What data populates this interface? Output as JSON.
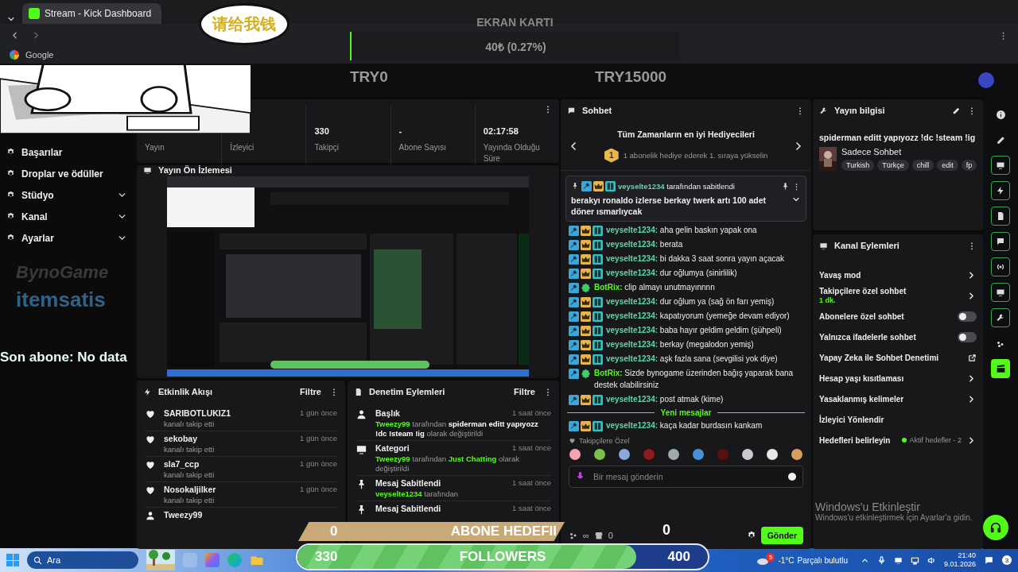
{
  "browser": {
    "tab_title": "Stream - Kick Dashboard",
    "bookmark": "Google"
  },
  "sticker": {
    "speech": "请给我钱"
  },
  "donation_widget": {
    "title": "EKRAN KARTI",
    "amount": "40₺ (0.27%)",
    "start": "TRY0",
    "goal": "TRY15000"
  },
  "sponsor_logos": [
    "BynoGame",
    "itemsatis"
  ],
  "sidebar": {
    "items": [
      {
        "label": "Başarılar",
        "kind": "link"
      },
      {
        "label": "Droplar ve ödüller",
        "kind": "link"
      },
      {
        "label": "Stüdyo",
        "kind": "group",
        "expanded": false
      },
      {
        "label": "Kanal",
        "kind": "group",
        "expanded": false
      },
      {
        "label": "Ayarlar",
        "kind": "group",
        "expanded": false
      }
    ]
  },
  "stats": [
    {
      "label": "Yayın"
    },
    {
      "label": "İzleyici"
    },
    {
      "value": "330",
      "label": "Takipçi"
    },
    {
      "value": "-",
      "label": "Abone Sayısı"
    },
    {
      "value": "02:17:58",
      "label": "Yayında Olduğu Süre"
    }
  ],
  "preview": {
    "title": "Yayın Ön İzlemesi",
    "kind": "picture"
  },
  "activity": {
    "title": "Etkinlik Akışı",
    "filter": "Filtre",
    "items": [
      {
        "kind": "follow",
        "name": "SARIBOTLUKIZ1",
        "detail": "kanalı takip etti",
        "time": "1 gün önce"
      },
      {
        "kind": "follow",
        "name": "sekobay",
        "detail": "kanalı takip etti",
        "time": "1 gün önce"
      },
      {
        "kind": "follow",
        "name": "sla7_ccp",
        "detail": "kanalı takip etti",
        "time": "1 gün önce"
      },
      {
        "kind": "follow",
        "name": "Nosokaljilker",
        "detail": "kanalı takip etti",
        "time": "1 gün önce"
      },
      {
        "kind": "user",
        "name": "Tweezy99"
      }
    ]
  },
  "moderation": {
    "title": "Denetim Eylemleri",
    "filter": "Filtre",
    "items": [
      {
        "kind": "title",
        "title": "Başlık",
        "time": "1 saat önce",
        "parts": [
          {
            "kind": "user",
            "text": "Tweezy99"
          },
          {
            "kind": "muted",
            "text": "tarafından"
          },
          {
            "kind": "value",
            "text": "spiderman editt yapıyozz !dc !steam !ig"
          },
          {
            "kind": "muted",
            "text": "olarak değiştirildi"
          }
        ]
      },
      {
        "kind": "category",
        "title": "Kategori",
        "time": "1 saat önce",
        "parts": [
          {
            "kind": "user",
            "text": "Tweezy99"
          },
          {
            "kind": "muted",
            "text": "tarafından"
          },
          {
            "kind": "user",
            "text": "Just Chatting"
          },
          {
            "kind": "muted",
            "text": "olarak değiştirildi"
          }
        ]
      },
      {
        "kind": "pin",
        "title": "Mesaj Sabitlendi",
        "time": "1 saat önce",
        "parts": [
          {
            "kind": "user",
            "text": "veyselte1234"
          },
          {
            "kind": "muted",
            "text": "tarafından"
          }
        ]
      },
      {
        "kind": "pin",
        "title": "Mesaj Sabitlendi",
        "time": "1 saat önce"
      }
    ]
  },
  "chat": {
    "title": "Sohbet",
    "gifters": {
      "title": "Tüm Zamanların en iyi Hediyecileri",
      "rank": "1",
      "text": "1 abonelik hediye ederek 1. sıraya yükselin"
    },
    "pinned": {
      "user": "veyselte1234",
      "note": "tarafından sabitlendi",
      "text": "berakyı ronaldo izlerse berkay twerk artı 100 adet döner ısmarlıycak"
    },
    "messages": [
      {
        "kind": "user",
        "user": "veyselte1234:",
        "text": "aha gelin baskın yapak ona"
      },
      {
        "kind": "user",
        "user": "veyselte1234:",
        "text": "berata"
      },
      {
        "kind": "user",
        "user": "veyselte1234:",
        "text": "bi dakka 3 saat sonra yayın açacak"
      },
      {
        "kind": "user",
        "user": "veyselte1234:",
        "text": "dur oğlumya (sinirlilik)"
      },
      {
        "kind": "bot",
        "user": "BotRix:",
        "text": "clip almayı unutmayınnnn"
      },
      {
        "kind": "user",
        "user": "veyselte1234:",
        "text": "dur oğlum ya (sağ ön farı yemiş)"
      },
      {
        "kind": "user",
        "user": "veyselte1234:",
        "text": "kapatıyorum (yemeğe devam ediyor)"
      },
      {
        "kind": "user",
        "user": "veyselte1234:",
        "text": "baba hayır geldim geldim (şühpeli)"
      },
      {
        "kind": "user",
        "user": "veyselte1234:",
        "text": "berkay (megalodon yemiş)"
      },
      {
        "kind": "user",
        "user": "veyselte1234:",
        "text": "aşk fazla sana (sevgilisi yok diye)"
      },
      {
        "kind": "bot",
        "user": "BotRix:",
        "text": "Sizde bynogame üzerinden bağış yaparak bana destek olabilirsiniz"
      },
      {
        "kind": "user",
        "user": "veyselte1234:",
        "text": "post atmak (kime)"
      }
    ],
    "divider": "Yeni mesajlar",
    "new_messages": [
      {
        "kind": "user",
        "user": "veyselte1234:",
        "text": "kaça kadar burdasın kankam"
      }
    ],
    "emote_section": "Takipçilere Özel",
    "placeholder": "Bir mesaj gönderin",
    "points": "∞",
    "store_count": "0",
    "send": "Gönder"
  },
  "stream_info": {
    "title": "Yayın bilgisi",
    "stream_title": "spiderman editt yapıyozz !dc !steam !ig",
    "category": "Sadece Sohbet",
    "tags": [
      "Turkish",
      "Türkçe",
      "chill",
      "edit",
      "fp"
    ]
  },
  "channel_actions": {
    "title": "Kanal Eylemleri",
    "items": [
      {
        "kind": "link",
        "label": "Yavaş mod"
      },
      {
        "kind": "link",
        "label": "Takipçilere özel sohbet",
        "detail": "1 dk."
      },
      {
        "kind": "toggle",
        "label": "Abonelere özel sohbet",
        "on": false
      },
      {
        "kind": "toggle",
        "label": "Yalnızca ifadelerle sohbet",
        "on": false
      },
      {
        "kind": "external",
        "label": "Yapay Zeka ile Sohbet Denetimi"
      },
      {
        "kind": "link",
        "label": "Hesap yaşı kısıtlaması"
      },
      {
        "kind": "link",
        "label": "Yasaklanmış kelimeler"
      },
      {
        "kind": "plain",
        "label": "İzleyici Yönlendir"
      },
      {
        "kind": "link",
        "label": "Hedefleri belirleyin",
        "status": "Aktif hedefler - 2"
      }
    ]
  },
  "overlay": {
    "last_sub": "Son abone: No data",
    "sub_goal": {
      "current": "0",
      "title": "ABONE HEDEFII",
      "target": "0"
    },
    "follower_goal": {
      "current": "330",
      "title": "FOLLOWERS",
      "target": "400",
      "level": 0.825
    }
  },
  "activation": {
    "title": "Windows'u Etkinleştir",
    "text": "Windows'u etkinleştirmek için Ayarlar'a gidin."
  },
  "taskbar": {
    "search": "Ara",
    "weather_badge": "5",
    "temperature": "-1°C",
    "weather": "Parçalı bulutlu",
    "time": "21:40",
    "date": "9.01.2026",
    "notifications": "3"
  }
}
